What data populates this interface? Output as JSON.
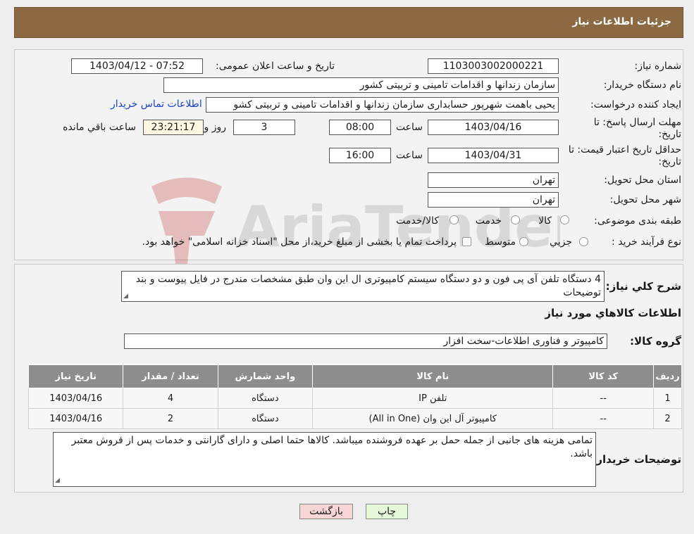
{
  "header": {
    "title": "جزئیات اطلاعات نیاز"
  },
  "form": {
    "need_number_label": "شماره نیاز:",
    "need_number": "1103003002000221",
    "announce_label": "تاریخ و ساعت اعلان عمومی:",
    "announce_value": "1403/04/12 - 07:52",
    "buyer_org_label": "نام دستگاه خریدار:",
    "buyer_org": "سازمان زندانها و اقدامات تامینی و تربیتی کشور",
    "requester_label": "ایجاد کننده درخواست:",
    "requester": "یحیی باهمت شهرپور حسابداری سازمان زندانها و اقدامات تامینی و تربیتی کشو",
    "contact_link": "اطلاعات تماس خریدار",
    "deadline_label_1": "مهلت ارسال پاسخ: تا",
    "deadline_label_2": "تاریخ:",
    "deadline_date": "1403/04/16",
    "time_label": "ساعت",
    "deadline_time": "08:00",
    "days_value": "3",
    "days_label": "روز و",
    "remaining_time": "23:21:17",
    "remaining_label": "ساعت باقي مانده",
    "validity_label_1": "حداقل تاریخ اعتبار قیمت: تا",
    "validity_label_2": "تاریخ:",
    "validity_date": "1403/04/31",
    "validity_time": "16:00",
    "province_label": "استان محل تحویل:",
    "province": "تهران",
    "city_label": "شهر محل تحویل:",
    "city": "تهران",
    "category_label": "طبقه بندی موضوعی:",
    "category_options": [
      "کالا",
      "خدمت",
      "کالا/خدمت"
    ],
    "process_label": "نوع فرآیند خرید :",
    "process_options": [
      "جزيي",
      "متوسط"
    ],
    "process_note": "پرداخت تمام یا بخشی از مبلغ خرید،از محل \"اسناد خزانه اسلامی\" خواهد بود."
  },
  "watermark": "AriaTender.neT",
  "details": {
    "summary_label": "شرح کلي نياز:",
    "summary": "4 دستگاه تلفن آی پی فون و دو دستگاه سیستم کامپیوتری ال این وان طبق مشخصات مندرج در فایل پیوست و بند توضیحات",
    "goods_info_title": "اطلاعات کالاهاي مورد نياز",
    "goods_group_label": "گروه کالا:",
    "goods_group": "کامپیوتر و فناوری اطلاعات-سخت افزار",
    "table": {
      "headers": [
        "رديف",
        "کد کالا",
        "نام کالا",
        "واحد شمارش",
        "تعداد / مقدار",
        "تاریخ نیاز"
      ],
      "rows": [
        [
          "1",
          "--",
          "تلفن IP",
          "دستگاه",
          "4",
          "1403/04/16"
        ],
        [
          "2",
          "--",
          "کامپیوتر آل این وان (All in One)",
          "دستگاه",
          "2",
          "1403/04/16"
        ]
      ]
    },
    "buyer_notes_label": "توضیحات خریدار:",
    "buyer_notes": "تمامی هزینه های جانبی از جمله حمل بر عهده فروشنده میباشد. کالاها حتما اصلی و دارای گارانتی و خدمات پس از فروش معتبر باشد."
  },
  "buttons": {
    "print": "چاپ",
    "back": "بازگشت"
  },
  "colors": {
    "header": "#8b6a43",
    "table_header": "#8d8d8d",
    "link": "#1a43c8",
    "back_button": "#f7d6d6",
    "print_button": "#e4f7d9"
  }
}
